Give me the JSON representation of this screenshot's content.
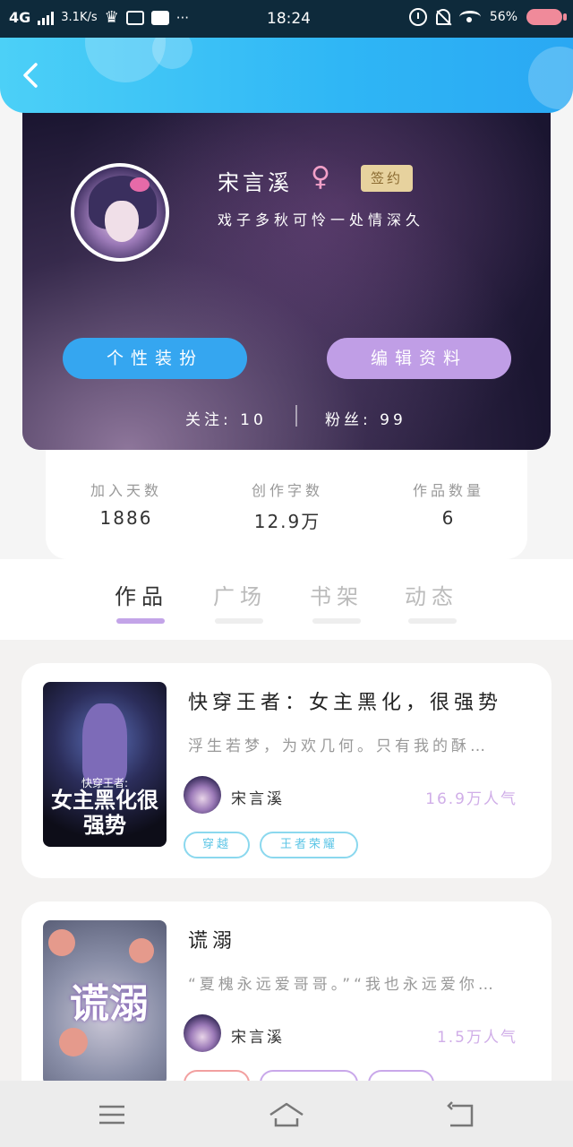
{
  "status_bar": {
    "network": "4G",
    "speed": "3.1K/s",
    "time": "18:24",
    "battery": "56%"
  },
  "profile": {
    "name": "宋言溪",
    "gender_symbol": "♀",
    "badge": "签约",
    "bio": "戏子多秋可怜一处情深久",
    "buttons": {
      "decorate": "个性装扮",
      "edit": "编辑资料"
    },
    "follow": "关注: 10",
    "fans": "粉丝: 99"
  },
  "stats": [
    {
      "label": "加入天数",
      "value": "1886"
    },
    {
      "label": "创作字数",
      "value": "12.9万"
    },
    {
      "label": "作品数量",
      "value": "6"
    }
  ],
  "tabs": [
    {
      "label": "作品",
      "active": true
    },
    {
      "label": "广场",
      "active": false
    },
    {
      "label": "书架",
      "active": false
    },
    {
      "label": "动态",
      "active": false
    }
  ],
  "books": [
    {
      "title": "快穿王者：女主黑化，很强势",
      "desc": "浮生若梦，为欢几何。只有我的酥…",
      "author": "宋言溪",
      "popularity": "16.9万人气",
      "tags": [
        "穿越",
        "王者荣耀"
      ],
      "cover_small": "快穿王者:",
      "cover_big": "女主黑化很强势"
    },
    {
      "title": "谎溺",
      "desc": "“夏槐永远爱哥哥。”“我也永远爱你…",
      "author": "宋言溪",
      "popularity": "1.5万人气",
      "cover_big": "谎溺"
    }
  ],
  "icons": {
    "back": "chevron-left-icon",
    "menu": "menu-icon",
    "home": "home-icon",
    "return": "back-arrow-icon"
  },
  "colors": {
    "header": "#2fb6f5",
    "accent_blue": "#35a6f0",
    "accent_purple": "#c09ee6",
    "popularity": "#d0aee8",
    "tag": "#5cc5e6"
  }
}
